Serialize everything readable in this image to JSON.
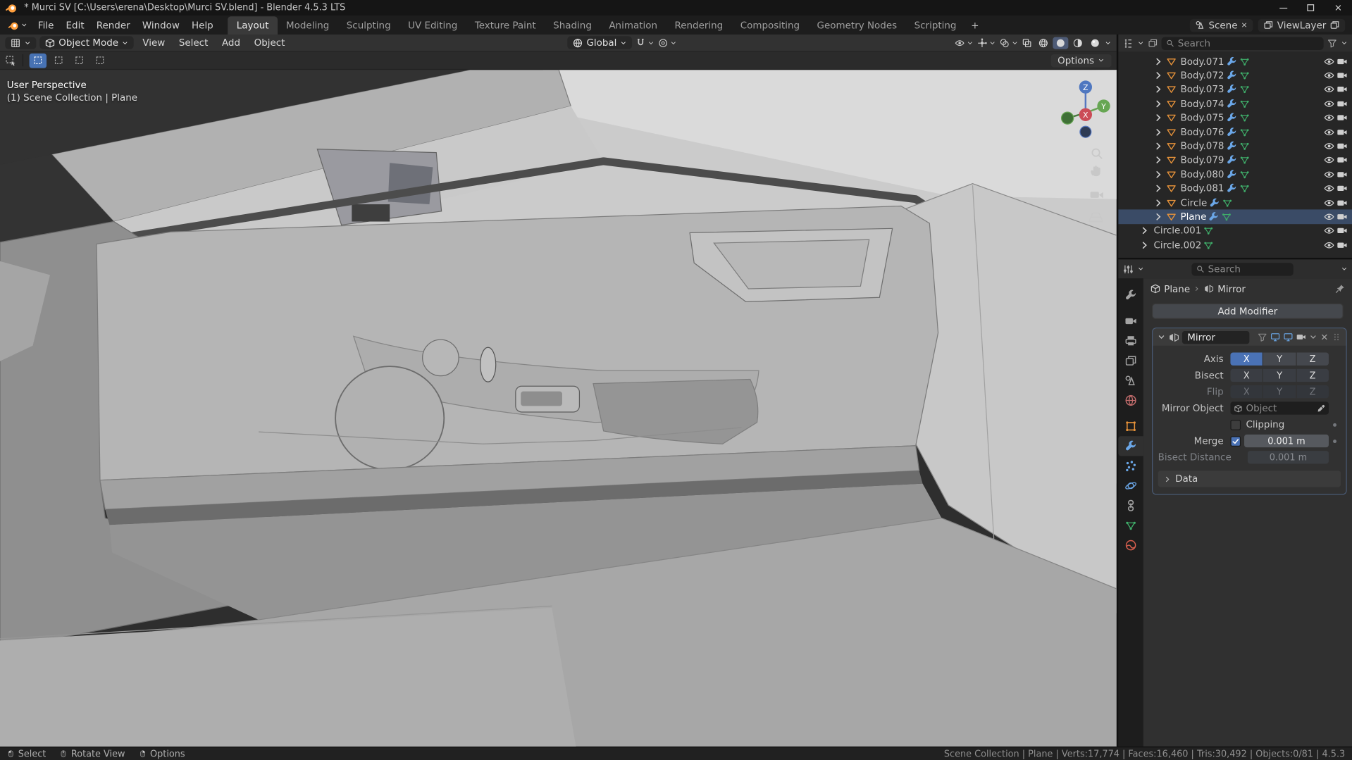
{
  "window": {
    "title": "* Murci SV [C:\\Users\\erena\\Desktop\\Murci SV.blend] - Blender 4.5.3 LTS"
  },
  "topbar": {
    "menus": [
      "File",
      "Edit",
      "Render",
      "Window",
      "Help"
    ],
    "workspaces": [
      "Layout",
      "Modeling",
      "Sculpting",
      "UV Editing",
      "Texture Paint",
      "Shading",
      "Animation",
      "Rendering",
      "Compositing",
      "Geometry Nodes",
      "Scripting"
    ],
    "active_workspace": "Layout",
    "add_workspace_label": "+",
    "scene_name": "Scene",
    "viewlayer_name": "ViewLayer"
  },
  "viewport": {
    "header": {
      "mode": "Object Mode",
      "menus": [
        "View",
        "Select",
        "Add",
        "Object"
      ],
      "orientation": "Global"
    },
    "toolbar": {
      "options_label": "Options"
    },
    "overlay": {
      "line1": "User Perspective",
      "line2": "(1) Scene Collection | Plane"
    },
    "gizmo_axes": {
      "x": "X",
      "y": "Y",
      "z": "Z"
    }
  },
  "outliner": {
    "search_placeholder": "Search",
    "rows": [
      {
        "label": "Body.071",
        "depth": 2,
        "type": "mesh",
        "mods": true
      },
      {
        "label": "Body.072",
        "depth": 2,
        "type": "mesh",
        "mods": true
      },
      {
        "label": "Body.073",
        "depth": 2,
        "type": "mesh",
        "mods": true
      },
      {
        "label": "Body.074",
        "depth": 2,
        "type": "mesh",
        "mods": true
      },
      {
        "label": "Body.075",
        "depth": 2,
        "type": "mesh",
        "mods": true
      },
      {
        "label": "Body.076",
        "depth": 2,
        "type": "mesh",
        "mods": true
      },
      {
        "label": "Body.078",
        "depth": 2,
        "type": "mesh",
        "mods": true
      },
      {
        "label": "Body.079",
        "depth": 2,
        "type": "mesh",
        "mods": true
      },
      {
        "label": "Body.080",
        "depth": 2,
        "type": "mesh",
        "mods": true
      },
      {
        "label": "Body.081",
        "depth": 2,
        "type": "mesh",
        "mods": true
      },
      {
        "label": "Circle",
        "depth": 2,
        "type": "mesh",
        "mods": true
      },
      {
        "label": "Plane",
        "depth": 2,
        "type": "mesh",
        "mods": true,
        "selected": true
      },
      {
        "label": "Circle.001",
        "depth": 1,
        "type": "curve",
        "mods": false
      },
      {
        "label": "Circle.002",
        "depth": 1,
        "type": "curve",
        "mods": false
      }
    ]
  },
  "properties": {
    "search_placeholder": "Search",
    "breadcrumb": {
      "object": "Plane",
      "modifier": "Mirror"
    },
    "add_modifier_label": "Add Modifier",
    "tabs": [
      "tool",
      "render",
      "output",
      "view-layer",
      "scene",
      "world",
      "object",
      "modifiers",
      "particles",
      "physics",
      "constraints",
      "data",
      "material"
    ],
    "active_tab": "modifiers",
    "modifier": {
      "name": "Mirror",
      "axis_label": "Axis",
      "bisect_label": "Bisect",
      "flip_label": "Flip",
      "xyz": [
        "X",
        "Y",
        "Z"
      ],
      "axis_active": "X",
      "mirror_object_label": "Mirror Object",
      "mirror_object_ghost": "Object",
      "clipping_label": "Clipping",
      "merge_label": "Merge",
      "merge_value": "0.001 m",
      "bisect_distance_label": "Bisect Distance",
      "bisect_distance_value": "0.001 m",
      "data_section_label": "Data"
    }
  },
  "status_bar": {
    "hints": [
      {
        "button": "left",
        "label": "Select"
      },
      {
        "button": "middle",
        "label": "Rotate View"
      },
      {
        "button": "right",
        "label": "Options"
      }
    ],
    "stats": "Scene Collection | Plane | Verts:17,774 | Faces:16,460 | Tris:30,492 | Objects:0/81 | 4.5.3"
  },
  "colors": {
    "accent": "#4772b3",
    "object_orange": "#e8933a",
    "data_green": "#3fae6a",
    "modifier_blue": "#6ba7e8",
    "selected_row": "#3a4b66"
  }
}
